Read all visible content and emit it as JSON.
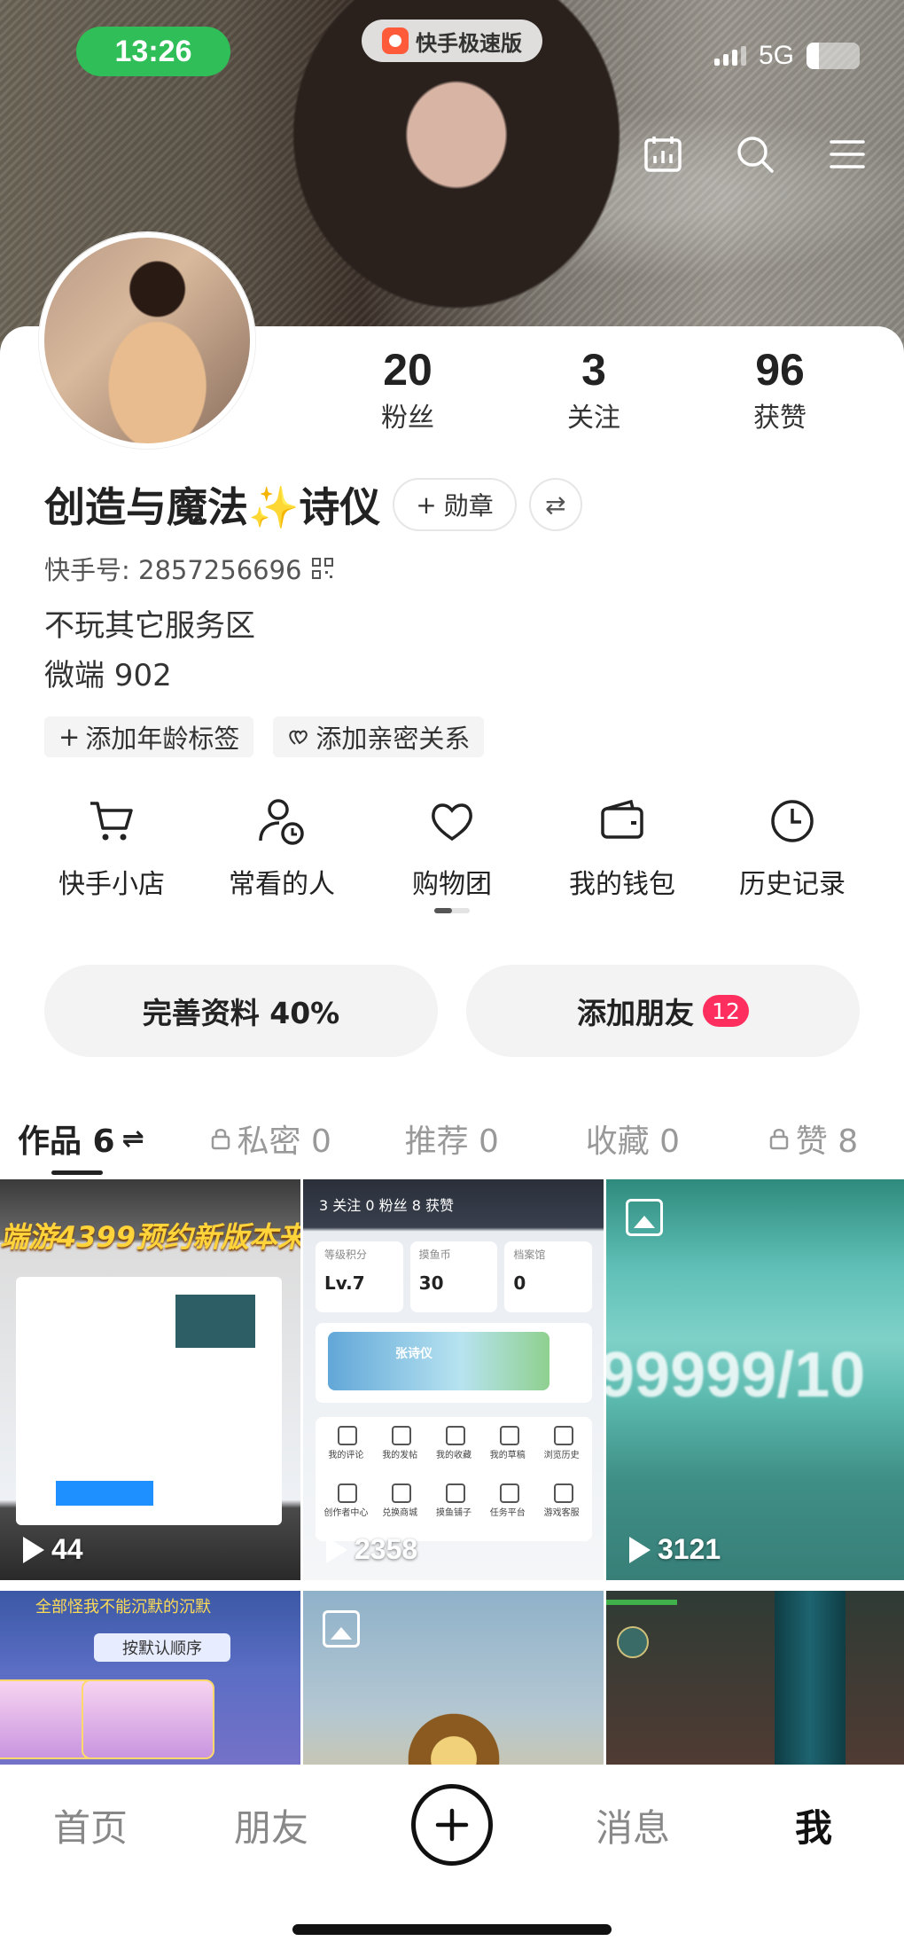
{
  "status_bar": {
    "time": "13:26",
    "network": "5G",
    "app_name": "快手极速版"
  },
  "header_icons": [
    "calendar-chart-icon",
    "search-icon",
    "menu-icon"
  ],
  "profile": {
    "stats": [
      {
        "num": "20",
        "label": "粉丝"
      },
      {
        "num": "3",
        "label": "关注"
      },
      {
        "num": "96",
        "label": "获赞"
      }
    ],
    "name": "创造与魔法✨诗仪",
    "medal_label": "勋章",
    "kuaishou_id": "快手号: 2857256696",
    "bio_lines": [
      "不玩其它服务区",
      "微端 902"
    ],
    "tags": [
      {
        "label": "添加年龄标签"
      },
      {
        "label": "添加亲密关系"
      }
    ]
  },
  "shortcuts": [
    {
      "label": "快手小店",
      "icon": "cart-icon"
    },
    {
      "label": "常看的人",
      "icon": "person-clock-icon"
    },
    {
      "label": "购物团",
      "icon": "heart-group-icon"
    },
    {
      "label": "我的钱包",
      "icon": "wallet-icon"
    },
    {
      "label": "历史记录",
      "icon": "clock-icon"
    }
  ],
  "actions": {
    "complete_profile": "完善资料 40%",
    "add_friend": "添加朋友",
    "add_friend_badge": "12"
  },
  "tabs": [
    {
      "label": "作品 6",
      "active": true,
      "locked": false
    },
    {
      "label": "私密 0",
      "active": false,
      "locked": true
    },
    {
      "label": "推荐 0",
      "active": false,
      "locked": false
    },
    {
      "label": "收藏 0",
      "active": false,
      "locked": false
    },
    {
      "label": "赞 8",
      "active": false,
      "locked": true
    }
  ],
  "grid": {
    "items": [
      {
        "count": "44",
        "banner": "端游4399预约新版本来"
      },
      {
        "count": "2358",
        "head": "3 关注  0 粉丝  8 获赞",
        "box1_k": "等级积分",
        "box1_v": "Lv.7",
        "box2_k": "摸鱼币",
        "box2_v": "30",
        "box3_k": "档案馆",
        "box3_v": "0",
        "game_name": "张诗仪",
        "menu": [
          "我的评论",
          "我的发帖",
          "我的收藏",
          "我的草稿",
          "浏览历史",
          "创作者中心",
          "兑换商城",
          "摸鱼铺子",
          "任务平台",
          "游戏客服"
        ]
      },
      {
        "count": "3121",
        "big_text": "99999/10"
      },
      {
        "top_text": "全部怪我不能沉默的沉默",
        "sort_label": "按默认顺序"
      },
      {},
      {}
    ]
  },
  "bottom_nav": [
    {
      "label": "首页",
      "active": false
    },
    {
      "label": "朋友",
      "active": false
    },
    {
      "label": "消息",
      "active": false
    },
    {
      "label": "我",
      "active": true
    }
  ]
}
